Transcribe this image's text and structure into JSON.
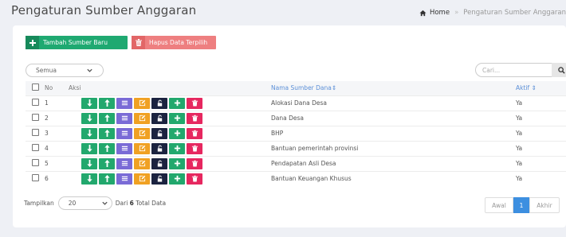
{
  "page": {
    "title": "Pengaturan Sumber Anggaran",
    "breadcrumb": {
      "home": "Home",
      "separator": "»",
      "current": "Pengaturan Sumber Anggaran"
    }
  },
  "toolbar": {
    "add_label": "Tambah Sumber Baru",
    "delete_label": "Hapus Data Terpilih"
  },
  "filter": {
    "selected": "Semua"
  },
  "search": {
    "placeholder": "Cari..."
  },
  "table": {
    "headers": {
      "no": "No",
      "aksi": "Aksi",
      "name": "Nama Sumber Dana⇕",
      "aktif": "Aktif ⇕"
    },
    "rows": [
      {
        "no": "1",
        "name": "Alokasi Dana Desa",
        "aktif": "Ya"
      },
      {
        "no": "2",
        "name": "Dana Desa",
        "aktif": "Ya"
      },
      {
        "no": "3",
        "name": "BHP",
        "aktif": "Ya"
      },
      {
        "no": "4",
        "name": "Bantuan pemerintah provinsi",
        "aktif": "Ya"
      },
      {
        "no": "5",
        "name": "Pendapatan Asli Desa",
        "aktif": "Ya"
      },
      {
        "no": "6",
        "name": "Bantuan Keuangan Khusus",
        "aktif": "Ya"
      }
    ]
  },
  "footer": {
    "show_label": "Tampilkan",
    "page_size": "20",
    "total_prefix": "Dari",
    "total_count": "6",
    "total_suffix": "Total Data"
  },
  "pagination": {
    "first": "Awal",
    "current": "1",
    "last": "Akhir"
  },
  "colors": {
    "green": "#1fa971",
    "red": "#ee7f80",
    "purple": "#7a6bd6",
    "orange": "#f0a123",
    "navy": "#1b2340",
    "pink": "#e6275f",
    "blue": "#3d8fe0"
  },
  "icons": [
    "home-icon",
    "plus-icon",
    "trash-icon",
    "chevron-down-icon",
    "search-icon",
    "arrow-down-icon",
    "arrow-up-icon",
    "list-icon",
    "edit-icon",
    "unlock-icon"
  ]
}
